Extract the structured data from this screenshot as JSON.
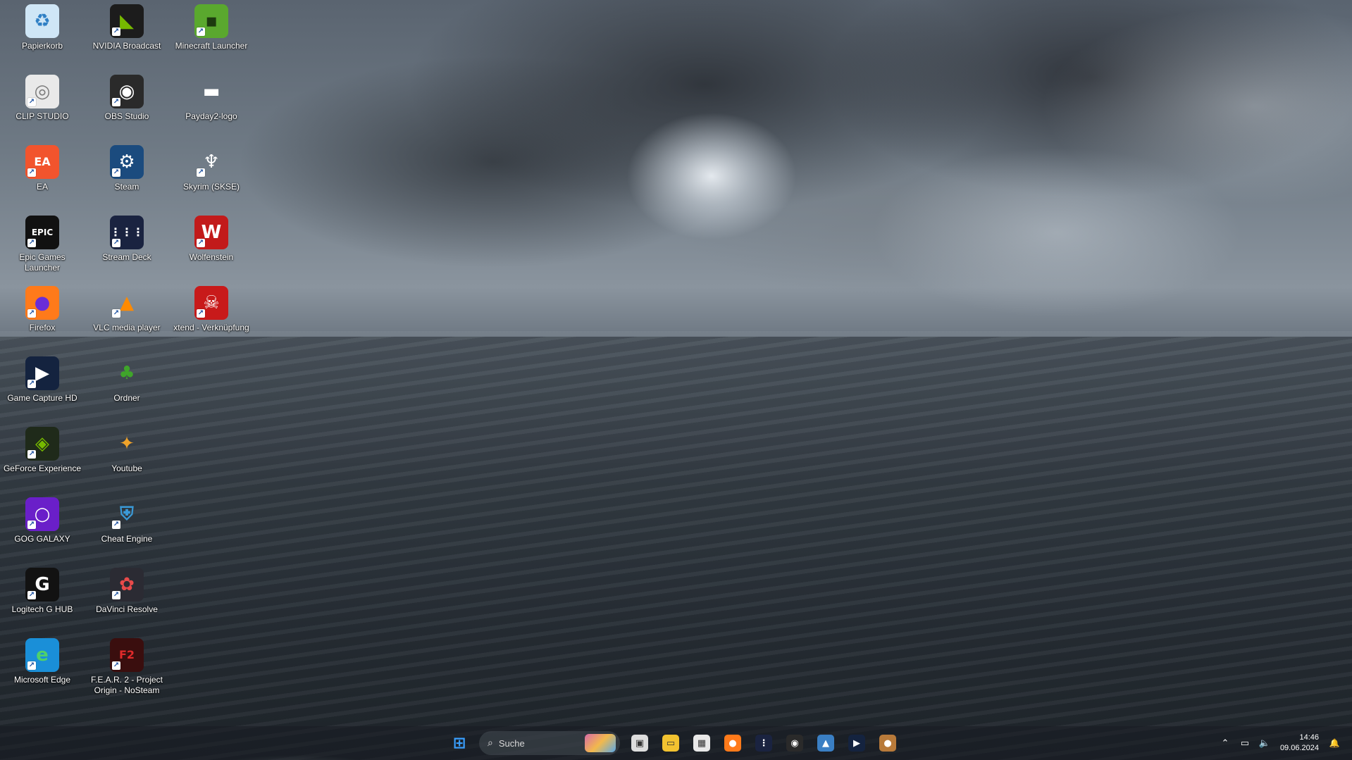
{
  "desktop": {
    "icons": [
      {
        "label": "Papierkorb",
        "icon": "recycle-bin-icon",
        "bg": "#cfe6f6",
        "fg": "#2f7fc4",
        "glyph": "♻",
        "shortcut": false
      },
      {
        "label": "NVIDIA Broadcast",
        "icon": "nvidia-broadcast-icon",
        "bg": "#1c1c1c",
        "fg": "#76b900",
        "glyph": "◣",
        "shortcut": true
      },
      {
        "label": "Minecraft Launcher",
        "icon": "minecraft-icon",
        "bg": "#5aa82e",
        "fg": "#1d3b0f",
        "glyph": "▪",
        "shortcut": true
      },
      {
        "label": "CLIP STUDIO",
        "icon": "clip-studio-icon",
        "bg": "#e9e9e9",
        "fg": "#7a7a7a",
        "glyph": "◎",
        "shortcut": true
      },
      {
        "label": "OBS Studio",
        "icon": "obs-studio-icon",
        "bg": "#2a2a2a",
        "fg": "#ffffff",
        "glyph": "◉",
        "shortcut": true
      },
      {
        "label": "Payday2-logo",
        "icon": "payday2-icon",
        "bg": "transparent",
        "fg": "#ffffff",
        "glyph": "▬",
        "shortcut": false
      },
      {
        "label": "EA",
        "icon": "ea-icon",
        "bg": "#f2542d",
        "fg": "#ffffff",
        "glyph": "EA",
        "shortcut": true
      },
      {
        "label": "Steam",
        "icon": "steam-icon",
        "bg": "#1b4b7e",
        "fg": "#ffffff",
        "glyph": "⚙",
        "shortcut": true
      },
      {
        "label": "Skyrim (SKSE)",
        "icon": "skyrim-icon",
        "bg": "transparent",
        "fg": "#ffffff",
        "glyph": "♆",
        "shortcut": true
      },
      {
        "label": "Epic Games Launcher",
        "icon": "epic-games-icon",
        "bg": "#111111",
        "fg": "#ffffff",
        "glyph": "EPIC",
        "shortcut": true
      },
      {
        "label": "Stream Deck",
        "icon": "stream-deck-icon",
        "bg": "#1a2340",
        "fg": "#ffffff",
        "glyph": "⋮⋮⋮",
        "shortcut": true
      },
      {
        "label": "Wolfenstein",
        "icon": "wolfenstein-icon",
        "bg": "#c21a1a",
        "fg": "#ffffff",
        "glyph": "W",
        "shortcut": true
      },
      {
        "label": "Firefox",
        "icon": "firefox-icon",
        "bg": "#ff7a1a",
        "fg": "#6a2dd8",
        "glyph": "●",
        "shortcut": true
      },
      {
        "label": "VLC media player",
        "icon": "vlc-icon",
        "bg": "transparent",
        "fg": "#ff8a00",
        "glyph": "▲",
        "shortcut": true
      },
      {
        "label": "xtend - Verknüpfung",
        "icon": "xtend-icon",
        "bg": "#c81a1a",
        "fg": "#ffffff",
        "glyph": "☠",
        "shortcut": true
      },
      {
        "label": "Game Capture HD",
        "icon": "game-capture-icon",
        "bg": "#14233f",
        "fg": "#ffffff",
        "glyph": "▶",
        "shortcut": true
      },
      {
        "label": "Ordner",
        "icon": "tree-folder-icon",
        "bg": "transparent",
        "fg": "#3fa52a",
        "glyph": "♣",
        "shortcut": false
      },
      {
        "label": "GeForce Experience",
        "icon": "geforce-icon",
        "bg": "#1f2a1a",
        "fg": "#76b900",
        "glyph": "◈",
        "shortcut": true
      },
      {
        "label": "Youtube",
        "icon": "youtube-icon",
        "bg": "transparent",
        "fg": "#f0a32a",
        "glyph": "✦",
        "shortcut": false
      },
      {
        "label": "GOG GALAXY",
        "icon": "gog-galaxy-icon",
        "bg": "#6a1fc9",
        "fg": "#ffffff",
        "glyph": "○",
        "shortcut": true
      },
      {
        "label": "Cheat Engine",
        "icon": "cheat-engine-icon",
        "bg": "transparent",
        "fg": "#3a9ad8",
        "glyph": "⛨",
        "shortcut": true
      },
      {
        "label": "Logitech G HUB",
        "icon": "logitech-ghub-icon",
        "bg": "#121212",
        "fg": "#ffffff",
        "glyph": "G",
        "shortcut": true
      },
      {
        "label": "DaVinci Resolve",
        "icon": "davinci-resolve-icon",
        "bg": "#2b2b33",
        "fg": "#e84a4a",
        "glyph": "✿",
        "shortcut": true
      },
      {
        "label": "Microsoft Edge",
        "icon": "edge-icon",
        "bg": "#1a8fd8",
        "fg": "#4fd16a",
        "glyph": "e",
        "shortcut": true
      },
      {
        "label": "F.E.A.R. 2 - Project Origin - NoSteam",
        "icon": "fear2-icon",
        "bg": "#3a0e0e",
        "fg": "#e02a2a",
        "glyph": "F2",
        "shortcut": true
      }
    ]
  },
  "taskbar": {
    "search_placeholder": "Suche",
    "apps": [
      {
        "icon": "windows-start-icon",
        "bg": "#1e90ff",
        "glyph": "⊞"
      },
      {
        "icon": "task-view-icon",
        "bg": "#dddddd",
        "glyph": "▣"
      },
      {
        "icon": "file-explorer-icon",
        "bg": "#f2c230",
        "glyph": "▭"
      },
      {
        "icon": "microsoft-store-icon",
        "bg": "#e8e8e8",
        "glyph": "▦"
      },
      {
        "icon": "firefox-icon",
        "bg": "#ff7a1a",
        "glyph": "●"
      },
      {
        "icon": "stream-deck-icon",
        "bg": "#1a2340",
        "glyph": "⋮"
      },
      {
        "icon": "obs-studio-icon",
        "bg": "#2a2a2a",
        "glyph": "◉"
      },
      {
        "icon": "photos-icon",
        "bg": "#3a7fc4",
        "glyph": "▲"
      },
      {
        "icon": "game-capture-icon",
        "bg": "#14233f",
        "glyph": "▶"
      },
      {
        "icon": "app-avatar-icon",
        "bg": "#b87a3a",
        "glyph": "●"
      }
    ],
    "tray": {
      "overflow_glyph": "⌃",
      "network_glyph": "▭",
      "volume_glyph": "🔈",
      "time": "14:46",
      "date": "09.06.2024",
      "notification_glyph": "🔔"
    }
  }
}
